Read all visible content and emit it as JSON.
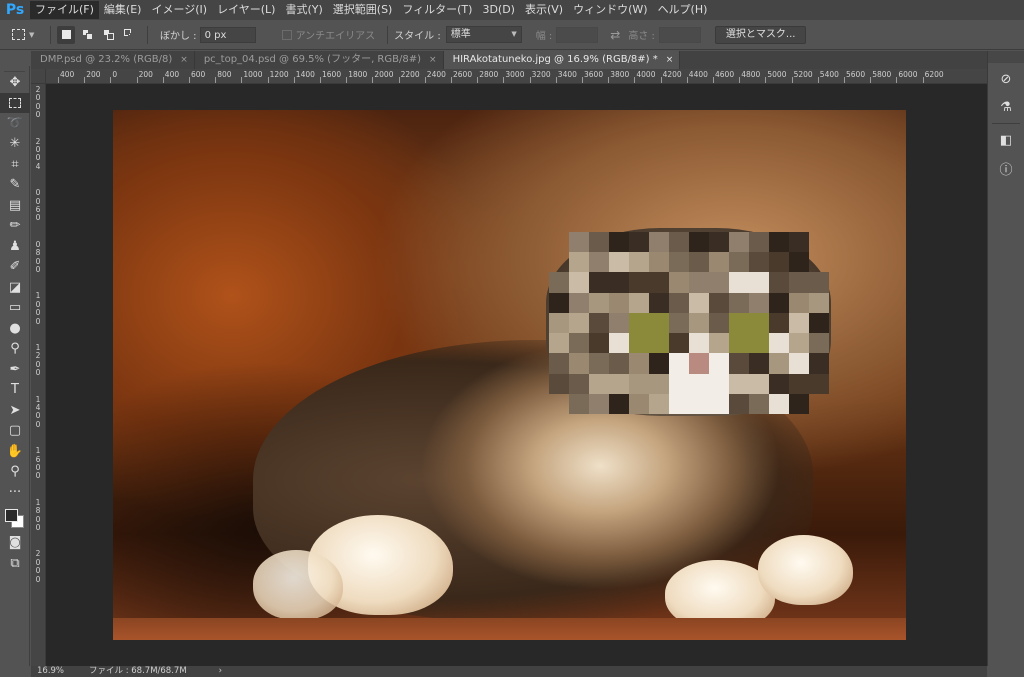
{
  "app": {
    "logo": "Ps"
  },
  "menu": [
    "ファイル(F)",
    "編集(E)",
    "イメージ(I)",
    "レイヤー(L)",
    "書式(Y)",
    "選択範囲(S)",
    "フィルター(T)",
    "3D(D)",
    "表示(V)",
    "ウィンドウ(W)",
    "ヘルプ(H)"
  ],
  "options": {
    "feather_label": "ぼかし :",
    "feather_value": "0 px",
    "antialias_label": "アンチエイリアス",
    "style_label": "スタイル :",
    "style_value": "標準",
    "width_label": "幅 :",
    "height_label": "高さ :",
    "mask_button": "選択とマスク..."
  },
  "tabs": [
    {
      "label": "DMP.psd @ 23.2% (RGB/8)",
      "close": "×"
    },
    {
      "label": "pc_top_04.psd @ 69.5% (フッター, RGB/8#)",
      "close": "×"
    },
    {
      "label": "HIRAkotatuneko.jpg @ 16.9% (RGB/8#) *",
      "close": "×"
    }
  ],
  "ruler_h": [
    "400",
    "200",
    "0",
    "200",
    "400",
    "600",
    "800",
    "1000",
    "1200",
    "1400",
    "1600",
    "1800",
    "2000",
    "2200",
    "2400",
    "2600",
    "2800",
    "3000",
    "3200",
    "3400",
    "3600",
    "3800",
    "4000",
    "4200",
    "4400",
    "4600",
    "4800",
    "5000",
    "5200",
    "5400",
    "5600",
    "5800",
    "6000",
    "6200"
  ],
  "ruler_v": [
    "2",
    "0",
    "0",
    "0",
    "2",
    "0",
    "0",
    "4",
    "0",
    "0",
    "6",
    "0",
    "0",
    "8",
    "0",
    "0",
    "1",
    "0",
    "0",
    "0",
    "1",
    "2",
    "0",
    "0",
    "1",
    "4",
    "0",
    "0",
    "1",
    "6",
    "0",
    "0",
    "1",
    "8",
    "0",
    "0",
    "2",
    "0",
    "0",
    "0"
  ],
  "toolbar": {
    "tools": [
      {
        "name": "move-tool",
        "icon": "✥"
      },
      {
        "name": "marquee-tool",
        "icon": ""
      },
      {
        "name": "lasso-tool",
        "icon": "➰"
      },
      {
        "name": "magic-wand-tool",
        "icon": "✳"
      },
      {
        "name": "crop-tool",
        "icon": "⌗"
      },
      {
        "name": "eyedropper-tool",
        "icon": "✎"
      },
      {
        "name": "healing-brush-tool",
        "icon": "▤"
      },
      {
        "name": "brush-tool",
        "icon": "✏"
      },
      {
        "name": "clone-stamp-tool",
        "icon": "♟"
      },
      {
        "name": "history-brush-tool",
        "icon": "✐"
      },
      {
        "name": "eraser-tool",
        "icon": "◪"
      },
      {
        "name": "gradient-tool",
        "icon": "▭"
      },
      {
        "name": "blur-tool",
        "icon": "●"
      },
      {
        "name": "dodge-tool",
        "icon": "⚲"
      },
      {
        "name": "pen-tool",
        "icon": "✒"
      },
      {
        "name": "type-tool",
        "icon": "T"
      },
      {
        "name": "path-selection-tool",
        "icon": "➤"
      },
      {
        "name": "rectangle-tool",
        "icon": "▢"
      },
      {
        "name": "hand-tool",
        "icon": "✋"
      },
      {
        "name": "zoom-tool",
        "icon": "⚲"
      },
      {
        "name": "edit-toolbar",
        "icon": "···"
      }
    ],
    "bottom": [
      {
        "name": "quick-mask-icon",
        "icon": "◙"
      },
      {
        "name": "screen-mode-icon",
        "icon": "⧉"
      }
    ]
  },
  "rpanel": [
    {
      "name": "libraries-icon",
      "icon": "⊘"
    },
    {
      "name": "adjustments-icon",
      "icon": "⚗"
    },
    {
      "name": "properties-icon",
      "icon": "◧"
    },
    {
      "name": "info-icon",
      "icon": "ⓘ"
    }
  ],
  "status": {
    "zoom": "16.9%",
    "doc": "ファイル : 68.7M/68.7M",
    "arrow": "›"
  }
}
